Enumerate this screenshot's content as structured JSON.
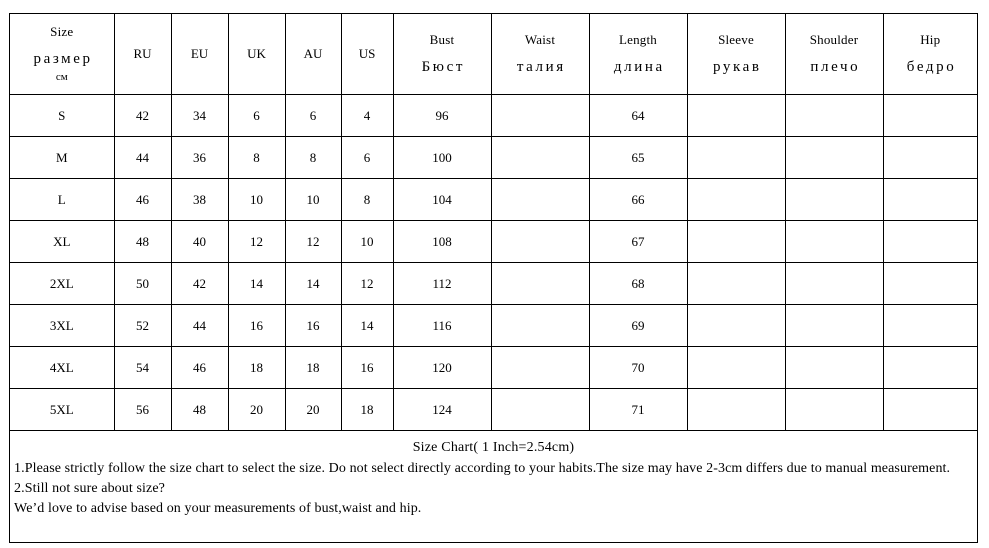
{
  "table": {
    "columns": [
      {
        "en": "Size",
        "ru": "размер",
        "sub": "см"
      },
      {
        "en": "RU",
        "ru": "",
        "sub": ""
      },
      {
        "en": "EU",
        "ru": "",
        "sub": ""
      },
      {
        "en": "UK",
        "ru": "",
        "sub": ""
      },
      {
        "en": "AU",
        "ru": "",
        "sub": ""
      },
      {
        "en": "US",
        "ru": "",
        "sub": ""
      },
      {
        "en": "Bust",
        "ru": "Бюст",
        "sub": ""
      },
      {
        "en": "Waist",
        "ru": "талия",
        "sub": ""
      },
      {
        "en": "Length",
        "ru": "длина",
        "sub": ""
      },
      {
        "en": "Sleeve",
        "ru": "рукав",
        "sub": ""
      },
      {
        "en": "Shoulder",
        "ru": "плечо",
        "sub": ""
      },
      {
        "en": "Hip",
        "ru": "бедро",
        "sub": ""
      }
    ],
    "rows": [
      {
        "size": "S",
        "ru": "42",
        "eu": "34",
        "uk": "6",
        "au": "6",
        "us": "4",
        "bust": "96",
        "waist": "",
        "length": "64",
        "sleeve": "",
        "shoulder": "",
        "hip": ""
      },
      {
        "size": "M",
        "ru": "44",
        "eu": "36",
        "uk": "8",
        "au": "8",
        "us": "6",
        "bust": "100",
        "waist": "",
        "length": "65",
        "sleeve": "",
        "shoulder": "",
        "hip": ""
      },
      {
        "size": "L",
        "ru": "46",
        "eu": "38",
        "uk": "10",
        "au": "10",
        "us": "8",
        "bust": "104",
        "waist": "",
        "length": "66",
        "sleeve": "",
        "shoulder": "",
        "hip": ""
      },
      {
        "size": "XL",
        "ru": "48",
        "eu": "40",
        "uk": "12",
        "au": "12",
        "us": "10",
        "bust": "108",
        "waist": "",
        "length": "67",
        "sleeve": "",
        "shoulder": "",
        "hip": ""
      },
      {
        "size": "2XL",
        "ru": "50",
        "eu": "42",
        "uk": "14",
        "au": "14",
        "us": "12",
        "bust": "112",
        "waist": "",
        "length": "68",
        "sleeve": "",
        "shoulder": "",
        "hip": ""
      },
      {
        "size": "3XL",
        "ru": "52",
        "eu": "44",
        "uk": "16",
        "au": "16",
        "us": "14",
        "bust": "116",
        "waist": "",
        "length": "69",
        "sleeve": "",
        "shoulder": "",
        "hip": ""
      },
      {
        "size": "4XL",
        "ru": "54",
        "eu": "46",
        "uk": "18",
        "au": "18",
        "us": "16",
        "bust": "120",
        "waist": "",
        "length": "70",
        "sleeve": "",
        "shoulder": "",
        "hip": ""
      },
      {
        "size": "5XL",
        "ru": "56",
        "eu": "48",
        "uk": "20",
        "au": "20",
        "us": "18",
        "bust": "124",
        "waist": "",
        "length": "71",
        "sleeve": "",
        "shoulder": "",
        "hip": ""
      }
    ]
  },
  "footer": {
    "title": "Size Chart( 1 Inch=2.54cm)",
    "note1": "1.Please strictly follow the size chart to select the size. Do not select directly according to your habits.The size may have 2-3cm differs due to manual measurement.",
    "note2": "2.Still not sure about size?",
    "note3": "We’d love to advise based on your measurements of bust,waist and hip."
  },
  "colors": {
    "border": "#000000",
    "text": "#000000",
    "background": "#ffffff"
  }
}
